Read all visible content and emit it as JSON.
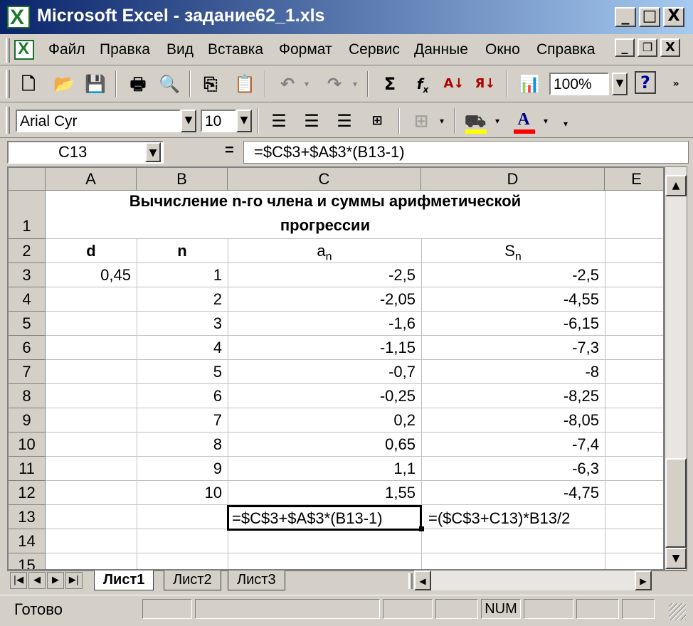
{
  "window": {
    "title": "Microsoft Excel - задание62_1.xls",
    "minimize": "_",
    "maximize": "□",
    "close": "X"
  },
  "menu": {
    "items": [
      "Файл",
      "Правка",
      "Вид",
      "Вставка",
      "Формат",
      "Сервис",
      "Данные",
      "Окно",
      "Справка"
    ]
  },
  "toolbar": {
    "zoom": "100%",
    "help_icon": "?"
  },
  "format_toolbar": {
    "font": "Arial Cyr",
    "size": "10"
  },
  "formula_bar": {
    "name_box": "C13",
    "equals": "=",
    "formula": "=$C$3+$A$3*(B13-1)"
  },
  "grid": {
    "columns": [
      "A",
      "B",
      "C",
      "D",
      "E"
    ],
    "rows": [
      "1",
      "2",
      "3",
      "4",
      "5",
      "6",
      "7",
      "8",
      "9",
      "10",
      "11",
      "12",
      "13",
      "14",
      "15"
    ],
    "title_line1": "Вычисление n-го члена и суммы арифметической",
    "title_line2": "прогрессии",
    "headers": {
      "d": "d",
      "n": "n",
      "a_base": "a",
      "a_sub": "n",
      "s_base": "S",
      "s_sub": "n"
    },
    "d_value": "0,45",
    "n_values": [
      "1",
      "2",
      "3",
      "4",
      "5",
      "6",
      "7",
      "8",
      "9",
      "10"
    ],
    "a_values": [
      "-2,5",
      "-2,05",
      "-1,6",
      "-1,15",
      "-0,7",
      "-0,25",
      "0,2",
      "0,65",
      "1,1",
      "1,55"
    ],
    "s_values": [
      "-2,5",
      "-4,55",
      "-6,15",
      "-7,3",
      "-8",
      "-8,25",
      "-8,05",
      "-7,4",
      "-6,3",
      "-4,75"
    ],
    "c13": "=$C$3+$A$3*(B13-1)",
    "d13": "=($C$3+C13)*B13/2"
  },
  "sheets": {
    "tabs": [
      "Лист1",
      "Лист2",
      "Лист3"
    ],
    "active": 0
  },
  "status": {
    "text": "Готово",
    "num": "NUM"
  }
}
